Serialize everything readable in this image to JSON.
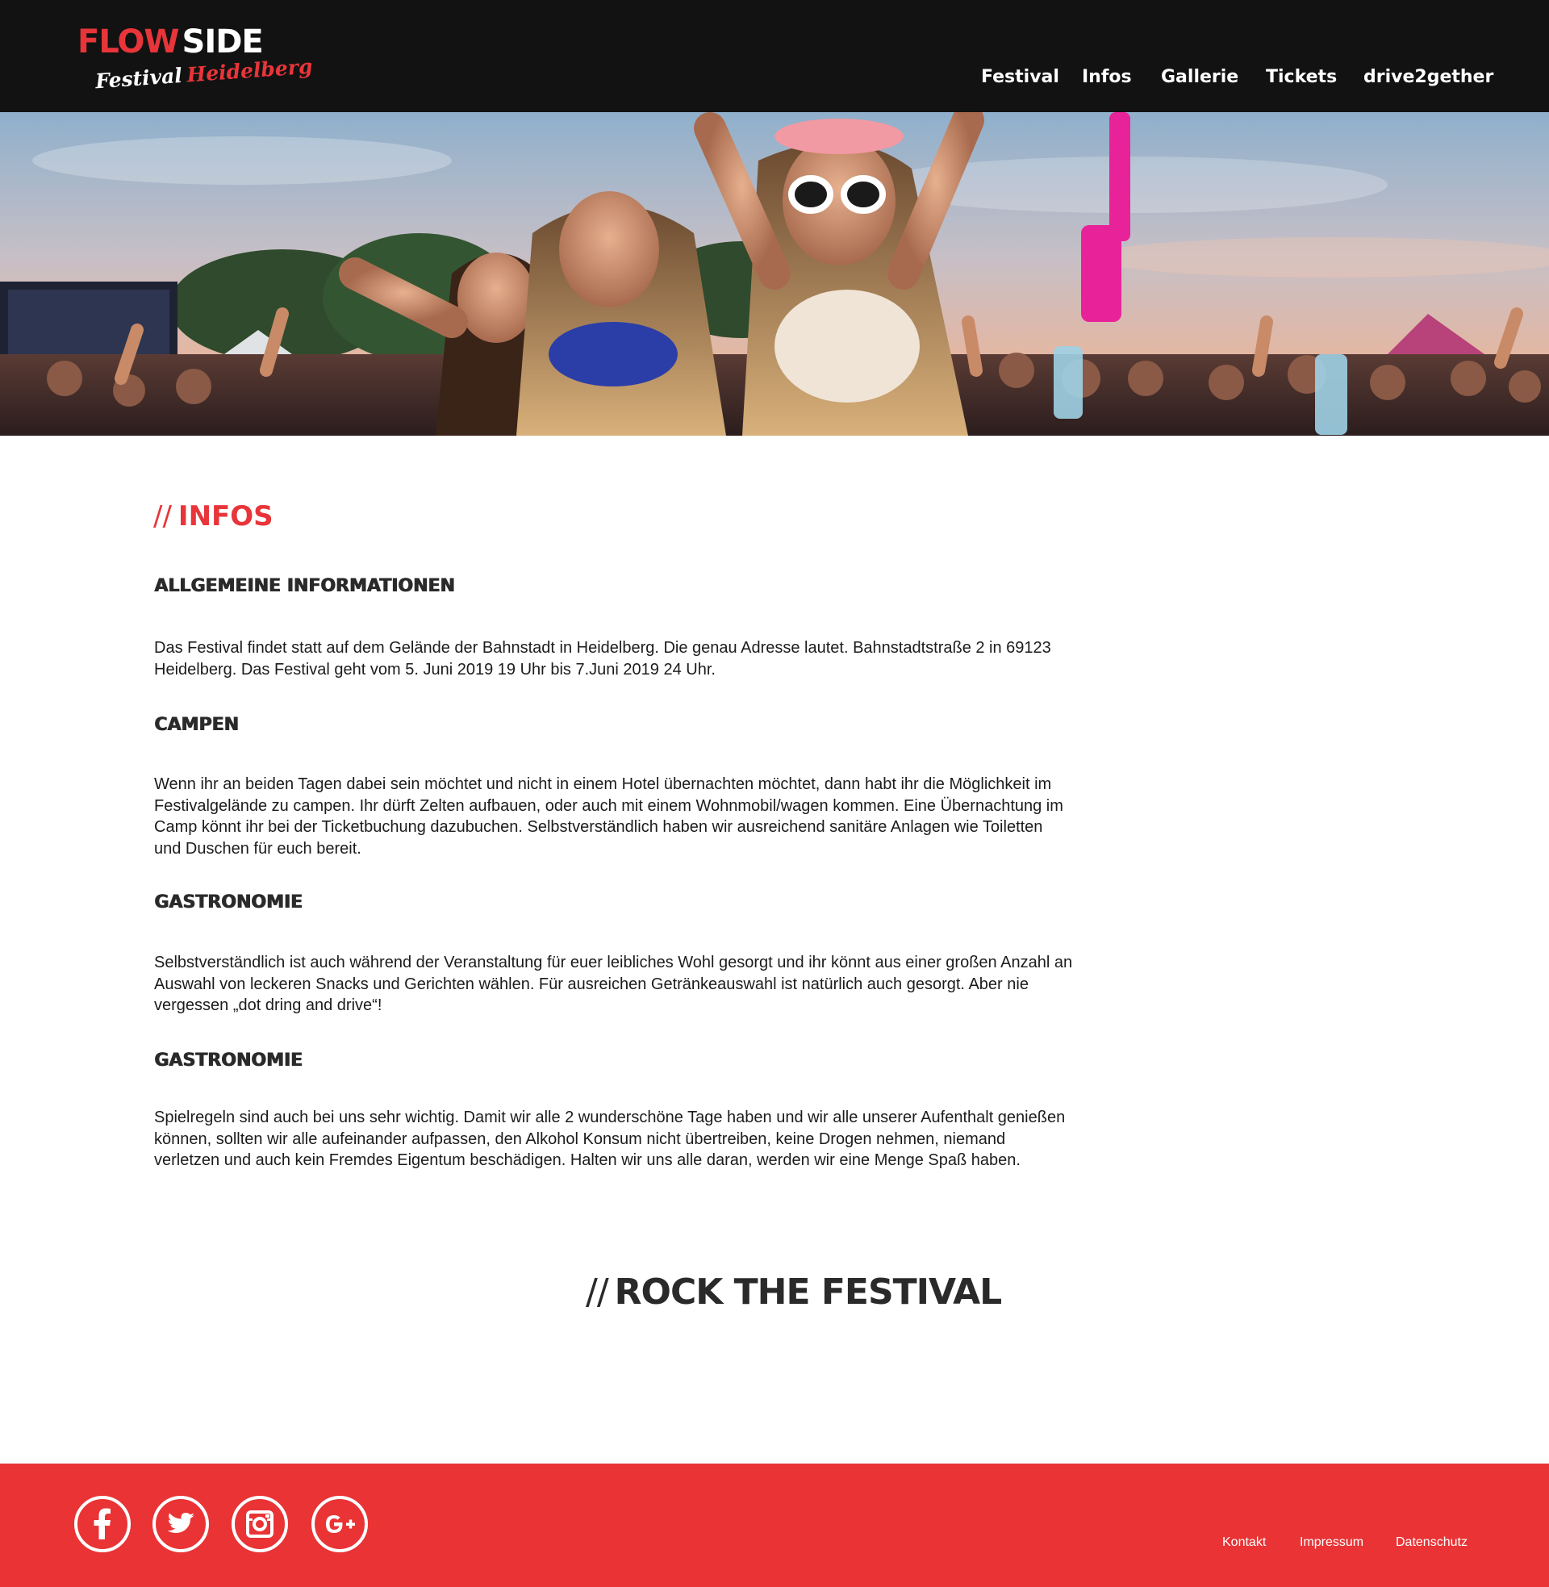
{
  "brand": {
    "logo_word1": "FLOW",
    "logo_word2": "SIDE",
    "logo_sub1": "Festival",
    "logo_sub2": "Heidelberg",
    "accent_color": "#e8353a",
    "header_bg": "#121212",
    "footer_bg": "#e93335"
  },
  "nav": {
    "items": [
      {
        "label": "Festival"
      },
      {
        "label": "Infos"
      },
      {
        "label": "Gallerie"
      },
      {
        "label": "Tickets"
      },
      {
        "label": "drive2gether"
      }
    ]
  },
  "hero": {
    "image": "festival-crowd-photo"
  },
  "main": {
    "title_prefix": "//",
    "title": "INFOS",
    "sections": [
      {
        "heading": "ALLGEMEINE INFORMATIONEN",
        "text": "Das Festival findet statt auf dem Gelände der Bahnstadt in Heidelberg. Die genau Adresse lautet. Bahnstadtstraße 2 in 69123 Heidelberg.  Das Festival geht vom 5. Juni 2019 19 Uhr bis 7.Juni 2019 24 Uhr."
      },
      {
        "heading": "CAMPEN",
        "text": "Wenn ihr an beiden Tagen dabei sein möchtet und nicht in einem Hotel übernachten möchtet, dann habt ihr die Möglichkeit im Festivalgelände zu campen. Ihr dürft Zelten aufbauen, oder auch mit einem Wohnmobil/wagen kommen. Eine Übernachtung im Camp könnt ihr bei der Ticketbuchung dazubuchen. Selbstverständlich haben wir ausreichend sanitäre Anlagen wie Toiletten und Duschen für euch bereit."
      },
      {
        "heading": "GASTRONOMIE",
        "text": "Selbstverständlich ist auch während der Veranstaltung für euer leibliches Wohl gesorgt und ihr könnt aus einer großen Anzahl an Auswahl von leckeren Snacks und Gerichten wählen. Für ausreichen Getränkeauswahl ist natürlich auch gesorgt. Aber nie vergessen „dot dring and drive“!"
      },
      {
        "heading": "GASTRONOMIE",
        "text": "Spielregeln sind auch bei uns sehr wichtig. Damit wir alle 2 wunderschöne Tage haben und wir alle unserer Aufenthalt genießen können, sollten wir alle aufeinander aufpassen, den Alkohol Konsum nicht übertreiben, keine Drogen nehmen, niemand verletzen und auch kein Fremdes Eigentum beschädigen. Halten wir uns alle daran, werden wir eine Menge Spaß haben."
      }
    ],
    "rock_prefix": "//",
    "rock_title": "ROCK THE FESTIVAL"
  },
  "footer": {
    "social": [
      {
        "icon": "facebook-icon"
      },
      {
        "icon": "twitter-icon"
      },
      {
        "icon": "instagram-icon"
      },
      {
        "icon": "google-plus-icon"
      }
    ],
    "links": [
      {
        "label": "Kontakt"
      },
      {
        "label": "Impressum"
      },
      {
        "label": "Datenschutz"
      }
    ]
  }
}
